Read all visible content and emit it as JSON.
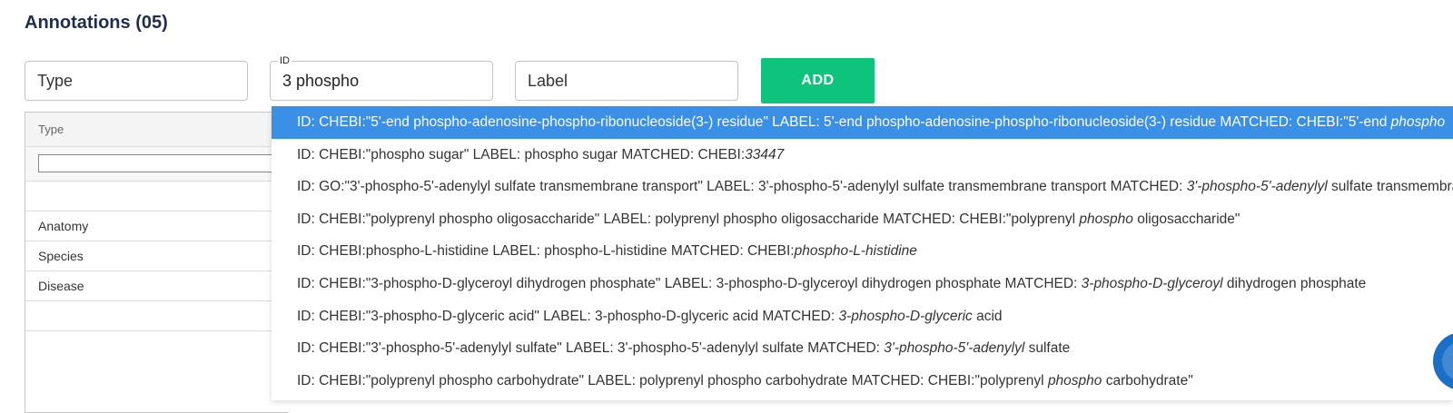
{
  "header": {
    "title": "Annotations (05)"
  },
  "form": {
    "type_placeholder": "Type",
    "id_label": "ID",
    "id_value": "3 phospho",
    "label_placeholder": "Label",
    "add_label": "ADD"
  },
  "table": {
    "header": "Type",
    "rows": [
      "",
      "Anatomy",
      "Species",
      "Disease",
      ""
    ]
  },
  "dropdown": {
    "options": [
      [
        {
          "t": "ID: CHEBI:\"5'-end phospho-adenosine-phospho-ribonucleoside(3-) residue\" LABEL: 5'-end phospho-adenosine-phospho-ribonucleoside(3-) residue MATCHED: CHEBI:\"5'-end "
        },
        {
          "t": "phospho",
          "i": true
        }
      ],
      [
        {
          "t": "ID: CHEBI:\"phospho sugar\" LABEL: phospho sugar MATCHED: CHEBI:"
        },
        {
          "t": "33447",
          "i": true
        }
      ],
      [
        {
          "t": "ID: GO:\"3'-phospho-5'-adenylyl sulfate transmembrane transport\" LABEL: 3'-phospho-5'-adenylyl sulfate transmembrane transport MATCHED: "
        },
        {
          "t": "3'-phospho-5'-adenylyl",
          "i": true
        },
        {
          "t": " sulfate transmembrane transport"
        }
      ],
      [
        {
          "t": "ID: CHEBI:\"polyprenyl phospho oligosaccharide\" LABEL: polyprenyl phospho oligosaccharide MATCHED: CHEBI:\"polyprenyl "
        },
        {
          "t": "phospho",
          "i": true
        },
        {
          "t": " oligosaccharide\""
        }
      ],
      [
        {
          "t": "ID: CHEBI:phospho-L-histidine LABEL: phospho-L-histidine MATCHED: CHEBI:"
        },
        {
          "t": "phospho-L-histidine",
          "i": true
        }
      ],
      [
        {
          "t": "ID: CHEBI:\"3-phospho-D-glyceroyl dihydrogen phosphate\" LABEL: 3-phospho-D-glyceroyl dihydrogen phosphate MATCHED: "
        },
        {
          "t": "3-phospho-D-glyceroyl",
          "i": true
        },
        {
          "t": " dihydrogen phosphate"
        }
      ],
      [
        {
          "t": "ID: CHEBI:\"3-phospho-D-glyceric acid\" LABEL: 3-phospho-D-glyceric acid MATCHED: "
        },
        {
          "t": "3-phospho-D-glyceric",
          "i": true
        },
        {
          "t": " acid"
        }
      ],
      [
        {
          "t": "ID: CHEBI:\"3'-phospho-5'-adenylyl sulfate\" LABEL: 3'-phospho-5'-adenylyl sulfate MATCHED: "
        },
        {
          "t": "3'-phospho-5'-adenylyl",
          "i": true
        },
        {
          "t": " sulfate"
        }
      ],
      [
        {
          "t": "ID: CHEBI:\"polyprenyl phospho carbohydrate\" LABEL: polyprenyl phospho carbohydrate MATCHED: CHEBI:\"polyprenyl "
        },
        {
          "t": "phospho",
          "i": true
        },
        {
          "t": " carbohydrate\""
        }
      ]
    ],
    "active_index": 0
  },
  "colors": {
    "accent": "#0ec37b",
    "highlight": "#3a8fe6",
    "title": "#1f2d4d"
  }
}
